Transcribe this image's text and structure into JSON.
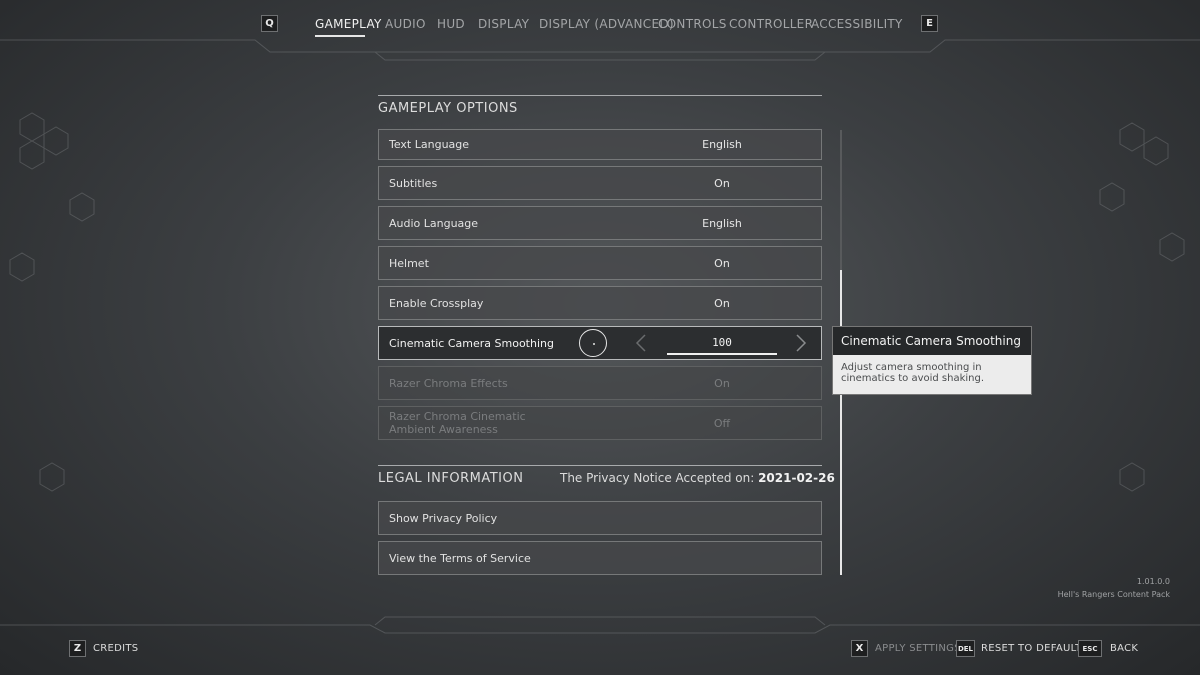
{
  "top_nav": {
    "prev_key": "Q",
    "next_key": "E",
    "tabs": [
      {
        "label": "GAMEPLAY",
        "active": true
      },
      {
        "label": "AUDIO"
      },
      {
        "label": "HUD"
      },
      {
        "label": "DISPLAY"
      },
      {
        "label": "DISPLAY (ADVANCED)"
      },
      {
        "label": "CONTROLS"
      },
      {
        "label": "CONTROLLER"
      },
      {
        "label": "ACCESSIBILITY"
      }
    ]
  },
  "gameplay_options": {
    "title": "GAMEPLAY OPTIONS",
    "rows": [
      {
        "label": "Text Language",
        "value": "English"
      },
      {
        "label": "Subtitles",
        "value": "On"
      },
      {
        "label": "Audio Language",
        "value": "English"
      },
      {
        "label": "Helmet",
        "value": "On"
      },
      {
        "label": "Enable Crossplay",
        "value": "On"
      },
      {
        "label": "Cinematic Camera Smoothing",
        "value": "100",
        "slider_fraction": 1.0,
        "selected": true
      },
      {
        "label": "Razer Chroma Effects",
        "value": "On",
        "disabled": true
      },
      {
        "label_line1": "Razer Chroma Cinematic",
        "label_line2": "Ambient Awareness",
        "value": "Off",
        "disabled": true
      }
    ]
  },
  "legal": {
    "title": "LEGAL INFORMATION",
    "privacy_prefix": "The Privacy Notice Accepted on:",
    "privacy_date": "2021-02-26",
    "rows": [
      {
        "label": "Show Privacy Policy"
      },
      {
        "label": "View the Terms of Service"
      }
    ]
  },
  "tooltip": {
    "title": "Cinematic Camera Smoothing",
    "description": "Adjust camera smoothing in cinematics to avoid shaking."
  },
  "version": {
    "number": "1.01.0.0",
    "content_pack": "Hell's Rangers Content Pack"
  },
  "footer": {
    "credits_key": "Z",
    "credits_label": "CREDITS",
    "apply_key": "X",
    "apply_label": "APPLY SETTINGS",
    "reset_key": "DEL",
    "reset_label": "RESET TO DEFAULTS",
    "back_key": "ESC",
    "back_label": "BACK"
  },
  "colors": {
    "background": "#3c3f42",
    "row_bg": "#46484a",
    "row_border": "#767879",
    "accent_text": "#f0f0f0",
    "tooltip_header": "#26282a",
    "tooltip_body": "#ececec"
  }
}
